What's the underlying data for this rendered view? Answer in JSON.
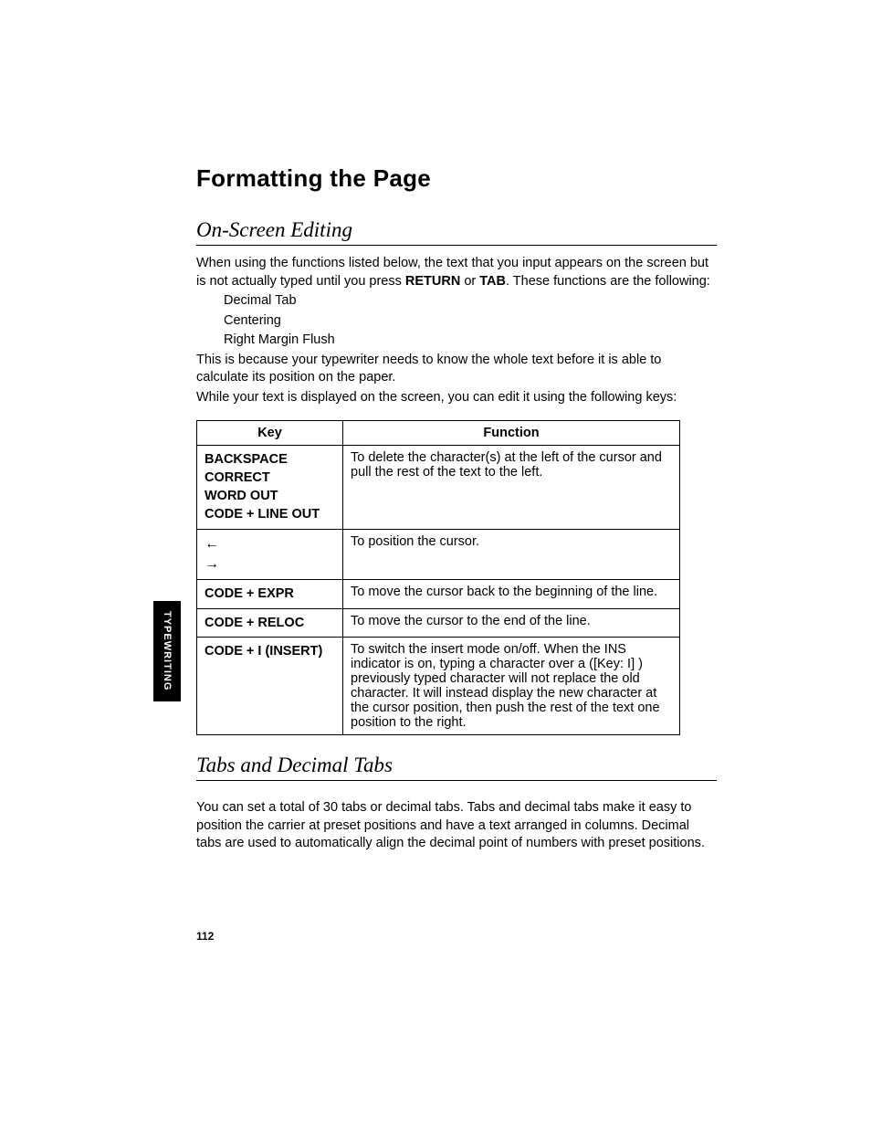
{
  "title": "Formatting the Page",
  "section1": {
    "heading": "On-Screen Editing",
    "p1a": "When using the functions listed below, the text that you input appears on the screen but is not actually typed until you press ",
    "p1b": "RETURN",
    "p1c": " or ",
    "p1d": "TAB",
    "p1e": ". These functions are the following:",
    "list1": "Decimal Tab",
    "list2": "Centering",
    "list3": "Right Margin Flush",
    "p2": "This is because your typewriter needs to know the whole text before it is able to calculate its position on the paper.",
    "p3": "While your text is displayed on the screen, you can edit it using the following keys:"
  },
  "table": {
    "h1": "Key",
    "h2": "Function",
    "r1k1": "BACKSPACE",
    "r1k2": "CORRECT",
    "r1k3": "WORD OUT",
    "r1k4": "CODE + LINE OUT",
    "r1f": "To delete the character(s) at the left of the cursor and pull the rest of the text to the left.",
    "r2k1": "←",
    "r2k2": "→",
    "r2f": "To position the cursor.",
    "r3k": "CODE + EXPR",
    "r3f": "To move the cursor back to the beginning of the line.",
    "r4k": "CODE + RELOC",
    "r4f": "To move the cursor to the end of the line.",
    "r5k": "CODE + I (INSERT)",
    "r5f": "To switch the insert mode on/off. When the INS indicator is on, typing a character over a ([Key: I] ) previously typed character will not replace the old character. It will instead display the new character at the cursor position, then push the rest of the text one position to the right."
  },
  "section2": {
    "heading": "Tabs and Decimal Tabs",
    "p1": "You can set a total of 30 tabs or decimal tabs. Tabs and decimal tabs make it easy to position the carrier at preset positions and have a text arranged in columns. Decimal tabs are used to automatically align the decimal point of numbers with preset positions."
  },
  "sidetab": "TYPEWRITING",
  "pagenum": "112"
}
